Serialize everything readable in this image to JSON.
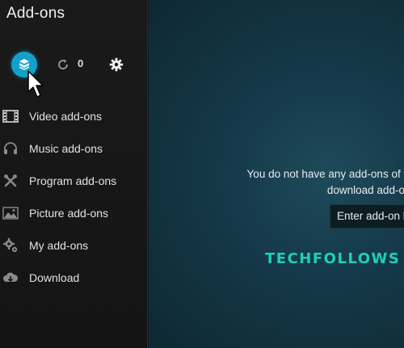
{
  "header": {
    "title": "Add-ons"
  },
  "toolbar": {
    "update_count": "0"
  },
  "sidebar": {
    "items": [
      {
        "label": "Video add-ons",
        "icon": "film-icon"
      },
      {
        "label": "Music add-ons",
        "icon": "headphones-icon"
      },
      {
        "label": "Program add-ons",
        "icon": "tools-icon"
      },
      {
        "label": "Picture add-ons",
        "icon": "picture-icon"
      },
      {
        "label": "My add-ons",
        "icon": "gear-cog-icon"
      },
      {
        "label": "Download",
        "icon": "cloud-download-icon"
      }
    ]
  },
  "main": {
    "message_line1": "You do not have any add-ons of this type in",
    "message_line2": "download add-ons created",
    "enter_button": "Enter add-on b",
    "watermark": "TECHFOLLOWS"
  },
  "colors": {
    "accent": "#14a0c8",
    "watermark": "#1fd0b4",
    "sidebar_bg": "#161616"
  }
}
